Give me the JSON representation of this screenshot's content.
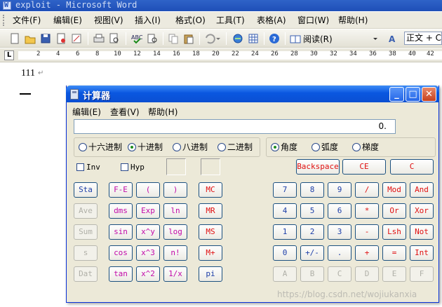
{
  "word": {
    "title": "exploit - Microsoft Word",
    "menu": [
      "文件(F)",
      "编辑(E)",
      "视图(V)",
      "插入(I)",
      "格式(O)",
      "工具(T)",
      "表格(A)",
      "窗口(W)",
      "帮助(H)"
    ],
    "toolbar": {
      "read_label": "阅读(R)",
      "style_value": "正文 + Ca"
    },
    "ruler_ticks": [
      "2",
      "4",
      "6",
      "8",
      "10",
      "12",
      "14",
      "16",
      "18",
      "20",
      "22",
      "24",
      "26",
      "28",
      "30",
      "32",
      "34",
      "36",
      "38",
      "40",
      "42"
    ],
    "document": {
      "line1": "111",
      "para_mark": "↵"
    }
  },
  "calculator": {
    "title": "计算器",
    "menu": [
      "编辑(E)",
      "查看(V)",
      "帮助(H)"
    ],
    "display": "0.",
    "number_systems": [
      "十六进制",
      "十进制",
      "八进制",
      "二进制"
    ],
    "selected_number_system": "十进制",
    "angle_units": [
      "角度",
      "弧度",
      "梯度"
    ],
    "selected_angle_unit": "角度",
    "checkboxes": [
      "Inv",
      "Hyp"
    ],
    "top_keys": [
      "Backspace",
      "CE",
      "C"
    ],
    "function_keys": [
      [
        "Sta",
        "F-E",
        "(",
        ")"
      ],
      [
        "Ave",
        "dms",
        "Exp",
        "ln"
      ],
      [
        "Sum",
        "sin",
        "x^y",
        "log"
      ],
      [
        "s",
        "cos",
        "x^3",
        "n!"
      ],
      [
        "Dat",
        "tan",
        "x^2",
        "1/x"
      ]
    ],
    "memory_keys": [
      "MC",
      "MR",
      "MS",
      "M+",
      "pi"
    ],
    "keypad": [
      [
        "7",
        "8",
        "9",
        "/",
        "Mod",
        "And"
      ],
      [
        "4",
        "5",
        "6",
        "*",
        "Or",
        "Xor"
      ],
      [
        "1",
        "2",
        "3",
        "-",
        "Lsh",
        "Not"
      ],
      [
        "0",
        "+/-",
        ".",
        "+",
        "=",
        "Int"
      ],
      [
        "A",
        "B",
        "C",
        "D",
        "E",
        "F"
      ]
    ]
  },
  "watermark": "https://blog.csdn.net/wojiukanxia"
}
